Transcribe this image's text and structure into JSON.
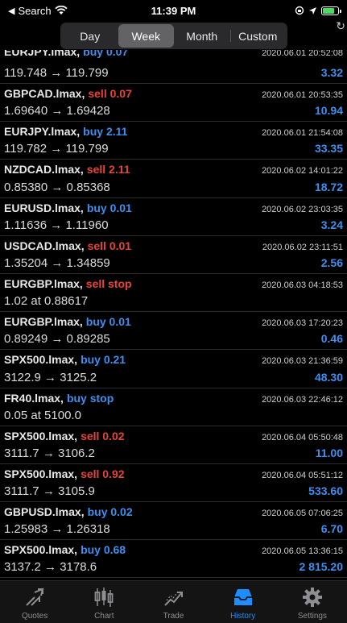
{
  "status_bar": {
    "back_label": "Search",
    "time": "11:39 PM"
  },
  "period_tabs": [
    {
      "label": "Day",
      "active": false
    },
    {
      "label": "Week",
      "active": true
    },
    {
      "label": "Month",
      "active": false
    },
    {
      "label": "Custom",
      "active": false
    }
  ],
  "deals": [
    {
      "symbol": "EURJPY.lmax,",
      "side": "buy 0.07",
      "type": "buy",
      "time": "2020.06.01 20:52:08",
      "prices": "119.748 → 119.799",
      "profit": "3.32"
    },
    {
      "symbol": "GBPCAD.lmax,",
      "side": "sell 0.07",
      "type": "sell",
      "time": "2020.06.01 20:53:35",
      "prices": "1.69640 → 1.69428",
      "profit": "10.94"
    },
    {
      "symbol": "EURJPY.lmax,",
      "side": "buy 2.11",
      "type": "buy",
      "time": "2020.06.01 21:54:08",
      "prices": "119.782 → 119.799",
      "profit": "33.35"
    },
    {
      "symbol": "NZDCAD.lmax,",
      "side": "sell 2.11",
      "type": "sell",
      "time": "2020.06.02 14:01:22",
      "prices": "0.85380 → 0.85368",
      "profit": "18.72"
    },
    {
      "symbol": "EURUSD.lmax,",
      "side": "buy 0.01",
      "type": "buy",
      "time": "2020.06.02 23:03:35",
      "prices": "1.11636 → 1.11960",
      "profit": "3.24"
    },
    {
      "symbol": "USDCAD.lmax,",
      "side": "sell 0.01",
      "type": "sell",
      "time": "2020.06.02 23:11:51",
      "prices": "1.35204 → 1.34859",
      "profit": "2.56"
    },
    {
      "symbol": "EURGBP.lmax,",
      "side": "sell stop",
      "type": "sell",
      "time": "2020.06.03 04:18:53",
      "prices": "1.02 at 0.88617",
      "profit": ""
    },
    {
      "symbol": "EURGBP.lmax,",
      "side": "buy 0.01",
      "type": "buy",
      "time": "2020.06.03 17:20:23",
      "prices": "0.89249 → 0.89285",
      "profit": "0.46"
    },
    {
      "symbol": "SPX500.lmax,",
      "side": "buy 0.21",
      "type": "buy",
      "time": "2020.06.03 21:36:59",
      "prices": "3122.9 → 3125.2",
      "profit": "48.30"
    },
    {
      "symbol": "FR40.lmax,",
      "side": "buy stop",
      "type": "buy",
      "time": "2020.06.03 22:46:12",
      "prices": "0.05 at 5100.0",
      "profit": ""
    },
    {
      "symbol": "SPX500.lmax,",
      "side": "sell 0.02",
      "type": "sell",
      "time": "2020.06.04 05:50:48",
      "prices": "3111.7 → 3106.2",
      "profit": "11.00"
    },
    {
      "symbol": "SPX500.lmax,",
      "side": "sell 0.92",
      "type": "sell",
      "time": "2020.06.04 05:51:12",
      "prices": "3111.7 → 3105.9",
      "profit": "533.60"
    },
    {
      "symbol": "GBPUSD.lmax,",
      "side": "buy 0.02",
      "type": "buy",
      "time": "2020.06.05 07:06:25",
      "prices": "1.25983 → 1.26318",
      "profit": "6.70"
    },
    {
      "symbol": "SPX500.lmax,",
      "side": "buy 0.68",
      "type": "buy",
      "time": "2020.06.05 13:36:15",
      "prices": "3137.2 → 3178.6",
      "profit": "2 815.20"
    }
  ],
  "tab_bar": [
    {
      "label": "Quotes",
      "icon": "quotes-icon",
      "active": false
    },
    {
      "label": "Chart",
      "icon": "chart-icon",
      "active": false
    },
    {
      "label": "Trade",
      "icon": "trade-icon",
      "active": false
    },
    {
      "label": "History",
      "icon": "history-icon",
      "active": true
    },
    {
      "label": "Settings",
      "icon": "settings-icon",
      "active": false
    }
  ],
  "colors": {
    "buy": "#3d8ff0",
    "sell": "#e8433a",
    "active_tab": "#1e8dff",
    "background": "#000000"
  }
}
